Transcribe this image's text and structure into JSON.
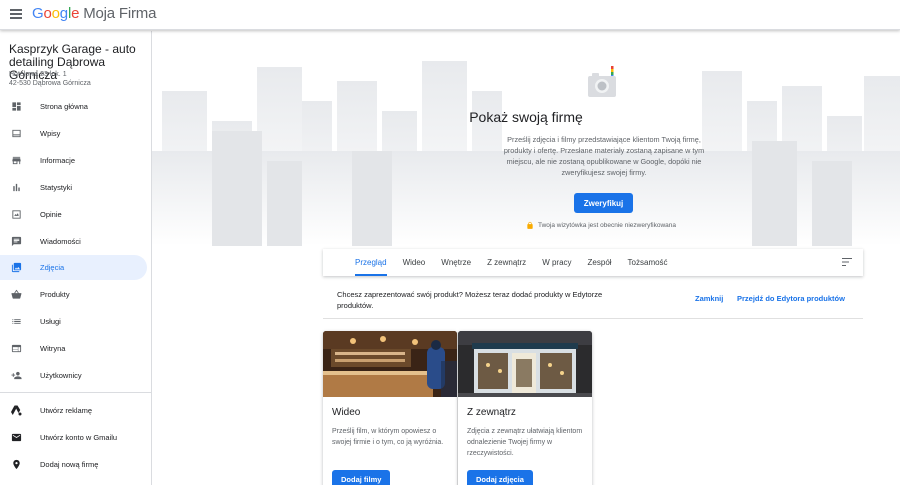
{
  "header": {
    "logo_letters": [
      "G",
      "o",
      "o",
      "g",
      "l",
      "e"
    ],
    "product": "Moja Firma"
  },
  "business": {
    "name": "Kasprzyk Garage - auto detailing Dąbrowa Górnicza",
    "address_line1": "Hotelowa 23 lok. 1",
    "address_line2": "42-530 Dąbrowa Górnicza"
  },
  "sidebar": {
    "items": [
      {
        "label": "Strona główna",
        "icon": "dashboard-icon"
      },
      {
        "label": "Wpisy",
        "icon": "posts-icon"
      },
      {
        "label": "Informacje",
        "icon": "storefront-icon"
      },
      {
        "label": "Statystyki",
        "icon": "bar-chart-icon"
      },
      {
        "label": "Opinie",
        "icon": "reviews-icon"
      },
      {
        "label": "Wiadomości",
        "icon": "message-icon"
      },
      {
        "label": "Zdjęcia",
        "icon": "photo-library-icon",
        "active": true
      },
      {
        "label": "Produkty",
        "icon": "basket-icon"
      },
      {
        "label": "Usługi",
        "icon": "list-icon"
      },
      {
        "label": "Witryna",
        "icon": "website-icon"
      },
      {
        "label": "Użytkownicy",
        "icon": "add-person-icon"
      }
    ],
    "extra_items": [
      {
        "label": "Utwórz reklamę",
        "icon": "google-ads-icon"
      },
      {
        "label": "Utwórz konto w Gmailu",
        "icon": "gmail-icon"
      },
      {
        "label": "Dodaj nową firmę",
        "icon": "location-pin-icon"
      }
    ]
  },
  "hero": {
    "title": "Pokaż swoją firmę",
    "description": "Prześlij zdjęcia i filmy przedstawiające klientom Twoją firmę, produkty i ofertę. Przesłane materiały zostaną zapisane w tym miejscu, ale nie zostaną opublikowane w Google, dopóki nie zweryfikujesz swojej firmy.",
    "verify_label": "Zweryfikuj",
    "unverified_note": "Twoja wizytówka jest obecnie niezweryfikowana"
  },
  "tabs": [
    {
      "label": "Przegląd",
      "active": true
    },
    {
      "label": "Wideo"
    },
    {
      "label": "Wnętrze"
    },
    {
      "label": "Z zewnątrz"
    },
    {
      "label": "W pracy"
    },
    {
      "label": "Zespół"
    },
    {
      "label": "Tożsamość"
    }
  ],
  "promo": {
    "text": "Chcesz zaprezentować swój produkt? Możesz teraz dodać produkty w Edytorze produktów.",
    "dismiss_label": "Zamknij",
    "go_label": "Przejdź do Edytora produktów"
  },
  "cards": [
    {
      "title": "Wideo",
      "description": "Prześlij film, w którym opowiesz o swojej firmie i o tym, co ją wyróżnia.",
      "button": "Dodaj filmy"
    },
    {
      "title": "Z zewnątrz",
      "description": "Zdjęcia z zewnątrz ułatwiają klientom odnalezienie Twojej firmy w rzeczywistości.",
      "button": "Dodaj zdjęcia"
    }
  ],
  "colors": {
    "accent": "#1a73e8",
    "active_bg": "#e8f0fe"
  }
}
